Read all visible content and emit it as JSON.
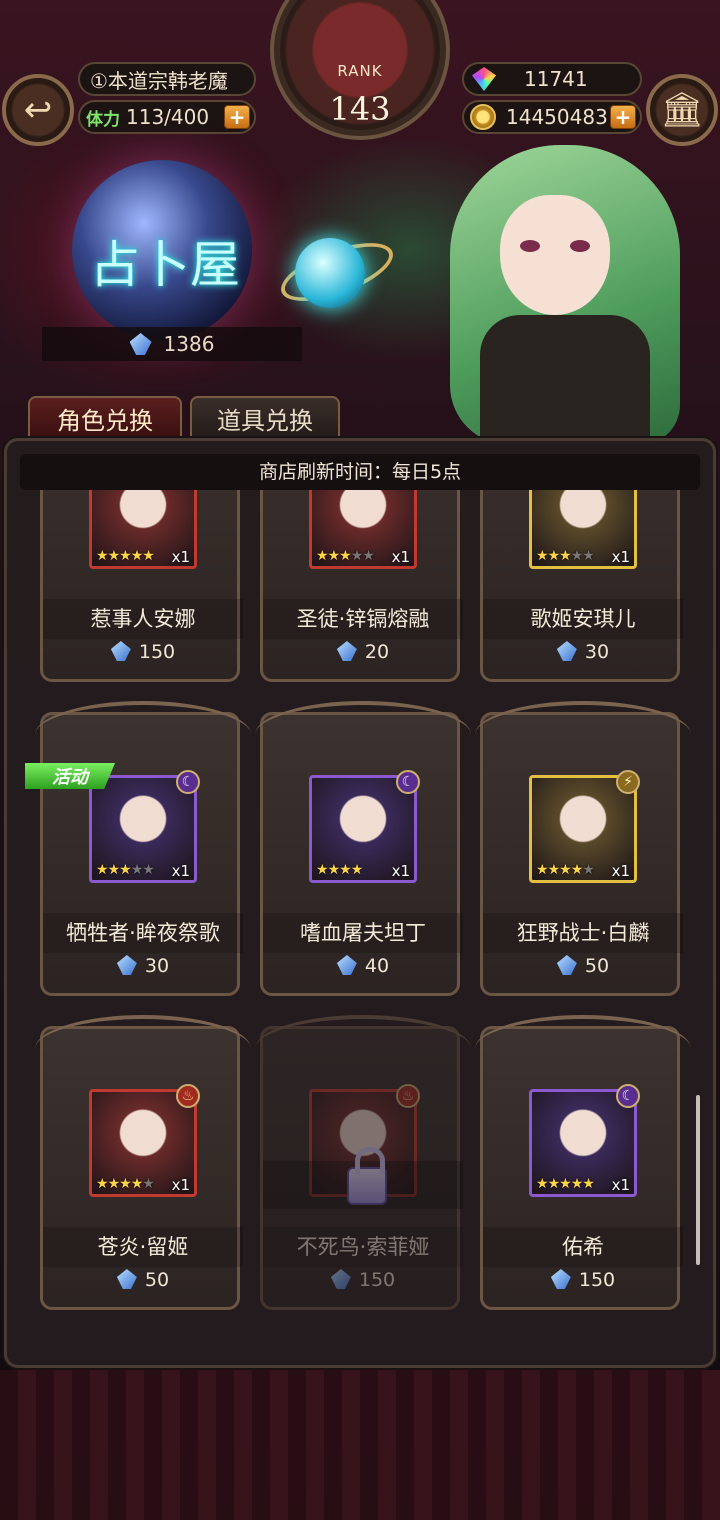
{
  "header": {
    "player_name": "①本道宗韩老魔",
    "stamina_label": "体力",
    "stamina_value": "113/400",
    "rank_label": "RANK",
    "rank_value": "143",
    "gems": "11741",
    "gold": "14450483",
    "back_icon": "back-arrow-icon",
    "menu_icon": "pillar-hall-icon"
  },
  "shop": {
    "title": "占卜屋",
    "crystal_balance": "1386",
    "tabs": [
      {
        "label": "角色兑换",
        "active": true
      },
      {
        "label": "道具兑换",
        "active": false
      }
    ],
    "refresh_text": "商店刷新时间：每日5点"
  },
  "items": [
    {
      "name": "惹事人安娜",
      "price": "150",
      "stars": 5,
      "max_stars": 5,
      "qty": "x1",
      "frame": "red",
      "element": ""
    },
    {
      "name": "圣徒·锌镉熔融",
      "price": "20",
      "stars": 3,
      "max_stars": 5,
      "qty": "x1",
      "frame": "red",
      "element": ""
    },
    {
      "name": "歌姬安琪儿",
      "price": "30",
      "stars": 3,
      "max_stars": 5,
      "qty": "x1",
      "frame": "gold",
      "element": ""
    },
    {
      "name": "牺牲者·眸夜祭歌",
      "price": "30",
      "stars": 3,
      "max_stars": 5,
      "qty": "x1",
      "frame": "purple",
      "element": "moon",
      "badge": "活动"
    },
    {
      "name": "嗜血屠夫坦丁",
      "price": "40",
      "stars": 4,
      "max_stars": 4,
      "qty": "x1",
      "frame": "purple",
      "element": "moon"
    },
    {
      "name": "狂野战士·白麟",
      "price": "50",
      "stars": 4,
      "max_stars": 5,
      "qty": "x1",
      "frame": "gold",
      "element": "bolt"
    },
    {
      "name": "苍炎·留姬",
      "price": "50",
      "stars": 4,
      "max_stars": 5,
      "qty": "x1",
      "frame": "red",
      "element": "fire"
    },
    {
      "name": "不死鸟·索菲娅",
      "price": "150",
      "stars": 0,
      "max_stars": 5,
      "qty": "",
      "frame": "red",
      "element": "fire",
      "locked": true
    },
    {
      "name": "佑希",
      "price": "150",
      "stars": 5,
      "max_stars": 5,
      "qty": "x1",
      "frame": "purple",
      "element": "moon"
    }
  ],
  "colors": {
    "accent_gold": "#c8a060",
    "stamina_green": "#7ee36a",
    "title_cyan": "#c9ffff",
    "event_green": "#2ea020"
  }
}
